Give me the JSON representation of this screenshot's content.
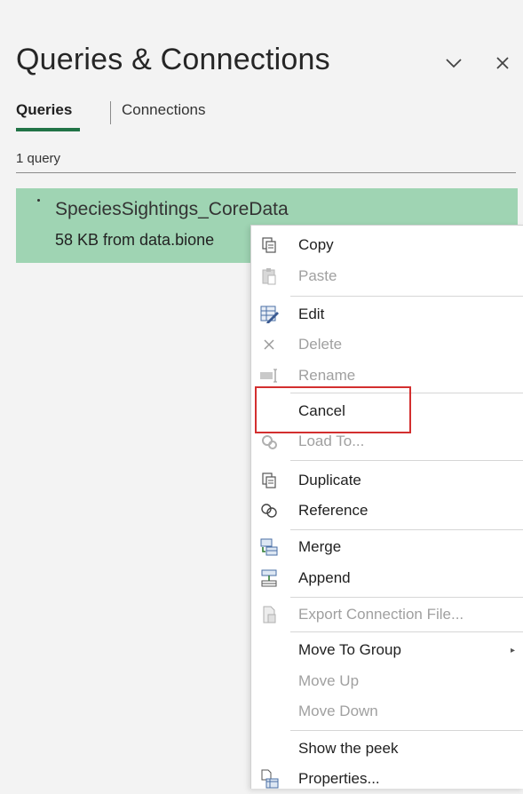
{
  "pane": {
    "title": "Queries & Connections",
    "tabs": [
      {
        "label": "Queries",
        "active": true
      },
      {
        "label": "Connections",
        "active": false
      }
    ],
    "count_label": "1 query"
  },
  "query": {
    "name": "SpeciesSightings_CoreData",
    "sub": "58 KB from data.bione"
  },
  "menu": {
    "items": [
      {
        "label": "Copy",
        "icon": "copy-icon",
        "enabled": true
      },
      {
        "label": "Paste",
        "icon": "paste-icon",
        "enabled": false
      },
      {
        "label": "Edit",
        "icon": "edit-icon",
        "enabled": true
      },
      {
        "label": "Delete",
        "icon": "delete-icon",
        "enabled": false
      },
      {
        "label": "Rename",
        "icon": "rename-icon",
        "enabled": false
      },
      {
        "label": "Cancel",
        "icon": "",
        "enabled": true
      },
      {
        "label": "Load To...",
        "icon": "load-to-icon",
        "enabled": false
      },
      {
        "label": "Duplicate",
        "icon": "duplicate-icon",
        "enabled": true
      },
      {
        "label": "Reference",
        "icon": "reference-icon",
        "enabled": true
      },
      {
        "label": "Merge",
        "icon": "merge-icon",
        "enabled": true
      },
      {
        "label": "Append",
        "icon": "append-icon",
        "enabled": true
      },
      {
        "label": "Export Connection File...",
        "icon": "export-file-icon",
        "enabled": false
      },
      {
        "label": "Move To Group",
        "icon": "",
        "enabled": true
      },
      {
        "label": "Move Up",
        "icon": "",
        "enabled": false
      },
      {
        "label": "Move Down",
        "icon": "",
        "enabled": false
      },
      {
        "label": "Show the peek",
        "icon": "",
        "enabled": true
      },
      {
        "label": "Properties...",
        "icon": "properties-icon",
        "enabled": true
      }
    ]
  },
  "colors": {
    "accent": "#217346",
    "selection": "#9fd4b3",
    "highlight_box": "#d32f2f"
  }
}
